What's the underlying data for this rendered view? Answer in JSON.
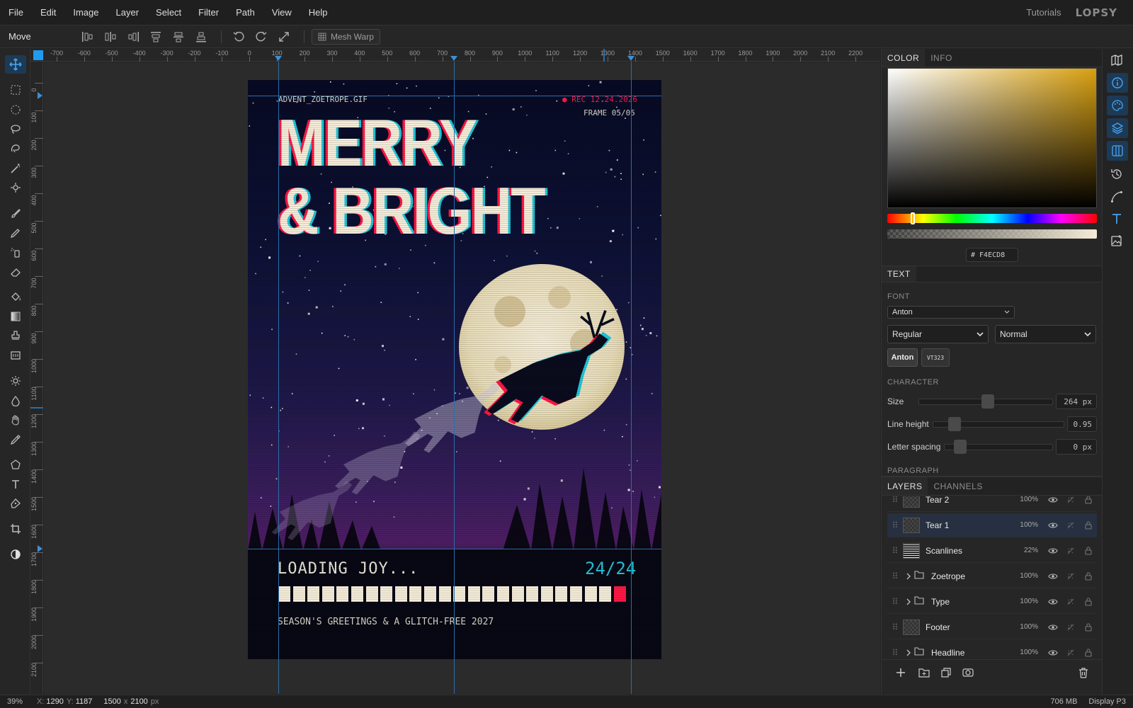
{
  "menubar": {
    "items": [
      "File",
      "Edit",
      "Image",
      "Layer",
      "Select",
      "Filter",
      "Path",
      "View",
      "Help"
    ],
    "tutorials": "Tutorials",
    "logo": "LOPSY"
  },
  "options": {
    "tool_name": "Move",
    "mesh_warp_label": "Mesh Warp"
  },
  "rulers": {
    "top_ticks": [
      "-700",
      "-600",
      "-500",
      "-400",
      "-300",
      "-200",
      "-100",
      "0",
      "100",
      "200",
      "300",
      "400",
      "500",
      "600",
      "700",
      "800",
      "900",
      "1000",
      "1100",
      "1200",
      "1300",
      "1400",
      "1500",
      "1600",
      "1700",
      "1800",
      "1900",
      "2000",
      "2100",
      "2200"
    ],
    "left_ticks": [
      "0",
      "100",
      "200",
      "300",
      "400",
      "500",
      "600",
      "700",
      "800",
      "900",
      "1000",
      "1100",
      "1200",
      "1300",
      "1400",
      "1500",
      "1600",
      "1700",
      "1800",
      "1900",
      "2000",
      "2100"
    ]
  },
  "poster": {
    "file_label": "ADVENT_ZOETROPE.GIF",
    "rec_label": "● REC 12.24.2026",
    "frame_label": "FRAME 05/05",
    "headline_line1": "MERRY",
    "headline_line2": "& BRIGHT",
    "loading_label": "LOADING JOY...",
    "progress_text": "24/24",
    "progress_fraction": 1.0,
    "greeting": "SEASON'S GREETINGS & A GLITCH-FREE 2027",
    "colors": {
      "cream": "#f4ecd8",
      "cyan": "#22c5d8",
      "red": "#ff1744",
      "sky": "#0d1135"
    }
  },
  "color_panel": {
    "tabs": [
      "COLOR",
      "INFO"
    ],
    "hex_prefix": "#",
    "hex_value": "F4ECD8",
    "hue_color": "#d8a010"
  },
  "text_panel": {
    "title": "TEXT",
    "font_label": "FONT",
    "font_value": "Anton",
    "style_value": "Regular",
    "weight_value": "Normal",
    "font_chips": [
      "Anton",
      "VT323"
    ],
    "character_label": "CHARACTER",
    "size_label": "Size",
    "size_value": "264 px",
    "line_height_label": "Line height",
    "line_height_value": "0.95",
    "letter_spacing_label": "Letter spacing",
    "letter_spacing_value": "0 px",
    "paragraph_label": "PARAGRAPH"
  },
  "layers_panel": {
    "tabs": [
      "LAYERS",
      "CHANNELS"
    ],
    "layers": [
      {
        "name": "Tear 2",
        "opacity": "100%",
        "folder": false
      },
      {
        "name": "Tear 1",
        "opacity": "100%",
        "folder": false,
        "selected": true
      },
      {
        "name": "Scanlines",
        "opacity": "22%",
        "folder": false
      },
      {
        "name": "Zoetrope",
        "opacity": "100%",
        "folder": true
      },
      {
        "name": "Type",
        "opacity": "100%",
        "folder": true
      },
      {
        "name": "Footer",
        "opacity": "100%",
        "folder": false
      },
      {
        "name": "Headline",
        "opacity": "100%",
        "folder": true
      }
    ]
  },
  "status": {
    "zoom": "39%",
    "x_label": "X:",
    "x_value": "1290",
    "y_label": "Y:",
    "y_value": "1187",
    "doc_w": "1500",
    "doc_x": "x",
    "doc_h": "2100",
    "doc_unit": "px",
    "memory": "706 MB",
    "profile": "Display P3"
  }
}
